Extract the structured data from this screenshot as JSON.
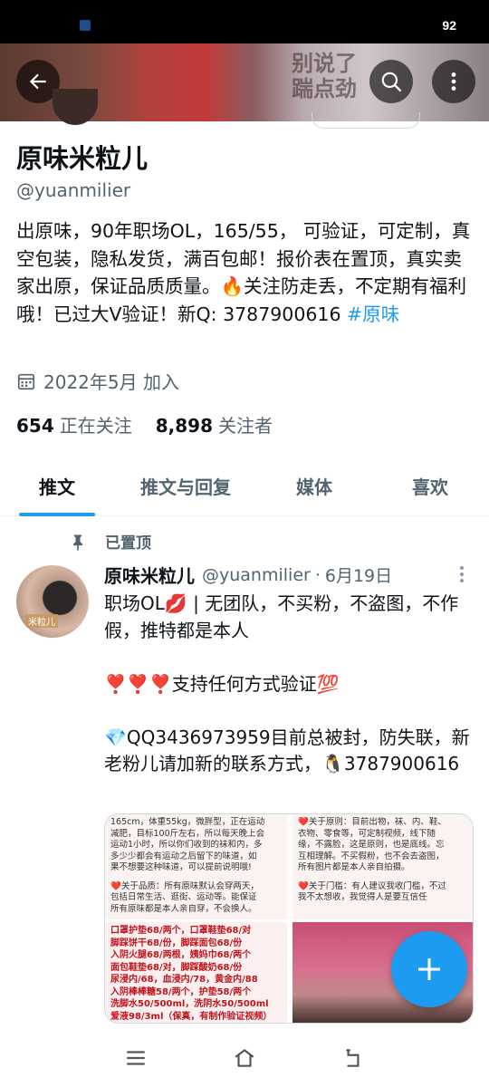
{
  "status_bar": {
    "battery": "92"
  },
  "banner": {
    "blurred_text": "别说了\n踹点劲"
  },
  "profile": {
    "name": "原味米粒儿",
    "handle": "@yuanmilier",
    "bio_text": "出原味，90年职场OL，165/55， 可验证，可定制，真空包装，隐私发货，满百包邮！报价表在置顶，真实卖家出原，保证品质质量。🔥关注防走丢，不定期有福利哦！已过大V验证！新Q: 3787900616 ",
    "bio_hashtag": "#原味",
    "joined": "2022年5月 加入",
    "following_count": "654",
    "following_label": "正在关注",
    "followers_count": "8,898",
    "followers_label": "关注者"
  },
  "tabs": [
    {
      "label": "推文",
      "active": true
    },
    {
      "label": "推文与回复",
      "active": false
    },
    {
      "label": "媒体",
      "active": false
    },
    {
      "label": "喜欢",
      "active": false
    }
  ],
  "pinned_label": "已置顶",
  "tweet": {
    "avatar_label": "米粒儿",
    "name": "原味米粒儿",
    "handle": "@yuanmilier",
    "dot": "·",
    "date": "6月19日",
    "line1": "职场OL💋 | 无团队，不买粉，不盗图，不作假，推特都是本人",
    "line2": "❣️❣️❣️支持任何方式验证💯",
    "line3": "💎QQ3436973959目前总被封，防失联，新老粉儿请加新的联系方式，🐧3787900616"
  },
  "media": {
    "m1_lines": [
      "165cm，体重55kg，微胖型，正在运动",
      "减肥，目标100斤左右，所以每天晚上会",
      "运动1小时，所以你们收到的袜和内，多",
      "多少少都会有运动之后留下的味道，如",
      "果不想要这种味道，可以提前说明哦!",
      "",
      "❤️关于品质：所有原味默认会穿两天，",
      "包括日常生活、逛街、运动等。能保证",
      "所有原味都是本人亲自穿，不会换人。"
    ],
    "m2_lines": [
      "❤️关于原则：目前出物，袜、内、鞋、",
      "衣物、零食等，可定制视频，线下随",
      "缘，不露脸，这是原则，也是底线。忘",
      "互相理解。不买假粉，也不会去盗图，",
      "所有图片都是本人亲自拍摄。",
      "",
      "❤️关于门槛：有人建议我收门槛，不过",
      "我不太想收，我觉得人是要互信任"
    ],
    "m3_lines": [
      "口罩护垫68/两个，口罩鞋垫68/对",
      "脚踩饼干68/份，脚踩面包68/份",
      "入阴火腿68/两根，姨妈巾68/两个",
      "面包鞋垫68/对，脚踩酸奶68/份",
      "尿浸内/68，血浸内/78，黄金内/88",
      "入阴棒棒糖58/两个，护垫58/两个",
      "洗脚水50/500ml，洗阴水50/500ml",
      "爱液98/3ml（保真，有制作验证视频）"
    ]
  },
  "colors": {
    "accent": "#1d9bf0",
    "text": "#0f1419",
    "muted": "#536471"
  }
}
